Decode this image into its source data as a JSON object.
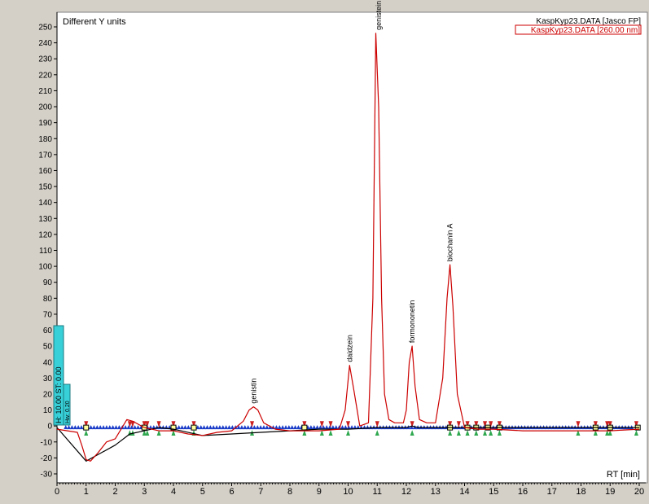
{
  "chart_data": {
    "type": "line",
    "title": "Different Y units",
    "xlabel": "RT [min]",
    "ylabel": "",
    "xlim": [
      0,
      20
    ],
    "ylim": [
      -35,
      255
    ],
    "x_ticks": [
      0,
      1,
      2,
      3,
      4,
      5,
      6,
      7,
      8,
      9,
      10,
      11,
      12,
      13,
      14,
      15,
      16,
      17,
      18,
      19,
      20
    ],
    "y_ticks": [
      -30,
      -20,
      -10,
      0,
      10,
      20,
      30,
      40,
      50,
      60,
      70,
      80,
      90,
      100,
      110,
      120,
      130,
      140,
      150,
      160,
      170,
      180,
      190,
      200,
      210,
      220,
      230,
      240,
      250
    ],
    "legend": {
      "placement": "top-right",
      "entries": [
        "KaspKyp23.DATA [Jasco FP]",
        "KaspKyp23.DATA [260.00 nm]"
      ]
    },
    "series": [
      {
        "name": "KaspKyp23.DATA [Jasco FP]",
        "color": "#000000",
        "x": [
          0,
          1.0,
          1.5,
          2.0,
          2.5,
          3.0,
          3.5,
          4.0,
          5.0,
          6.0,
          7.0,
          8.0,
          9.0,
          10.0,
          11.0,
          12.0,
          12.2,
          12.4,
          13.0,
          14.0,
          15.0,
          16.0,
          17.0,
          18.0,
          19.0,
          20.0
        ],
        "y": [
          -1,
          -22,
          -17,
          -12,
          -5,
          -3,
          -1,
          -2,
          -6,
          -5,
          -4,
          -3,
          -2,
          -2,
          -1,
          -1,
          0,
          -1,
          -1,
          -1,
          -1,
          -1,
          -1,
          -1,
          -1,
          -1
        ]
      },
      {
        "name": "KaspKyp23.DATA [260.00 nm]",
        "color": "#cc0000",
        "x": [
          0,
          0.7,
          0.85,
          1.0,
          1.15,
          1.4,
          1.7,
          2.0,
          2.2,
          2.4,
          2.6,
          3.0,
          3.5,
          4.0,
          4.5,
          5.0,
          5.5,
          6.0,
          6.4,
          6.6,
          6.75,
          6.9,
          7.1,
          7.5,
          8.0,
          9.0,
          9.7,
          9.9,
          10.05,
          10.2,
          10.4,
          10.7,
          10.85,
          10.95,
          11.05,
          11.15,
          11.25,
          11.4,
          11.6,
          11.9,
          12.0,
          12.1,
          12.2,
          12.3,
          12.45,
          12.7,
          13.0,
          13.25,
          13.4,
          13.5,
          13.6,
          13.75,
          14.0,
          14.5,
          15.0,
          16.0,
          17.0,
          18.0,
          19.0,
          20.0
        ],
        "y": [
          -2,
          -4,
          -12,
          -21,
          -22,
          -17,
          -10,
          -8,
          -2,
          4,
          3,
          -1,
          -3,
          -3,
          -5,
          -6,
          -4,
          -3,
          3,
          10,
          12,
          10,
          2,
          -2,
          -3,
          -3,
          -2,
          10,
          38,
          22,
          0,
          2,
          80,
          246,
          200,
          80,
          20,
          4,
          2,
          2,
          10,
          40,
          50,
          25,
          4,
          2,
          2,
          30,
          80,
          101,
          75,
          20,
          -1,
          -2,
          -2,
          -3,
          -3,
          -3,
          -3,
          -2
        ]
      }
    ],
    "annotations": [
      {
        "text": "genistin",
        "x": 6.75,
        "y": 12
      },
      {
        "text": "daidzein",
        "x": 10.05,
        "y": 38
      },
      {
        "text": "genistein",
        "x": 11.05,
        "y": 246
      },
      {
        "text": "formononetin",
        "x": 12.2,
        "y": 50
      },
      {
        "text": "biochanin A",
        "x": 13.5,
        "y": 101
      }
    ],
    "side_labels": [
      "H: 10.00  ST: 0.00",
      "Hw: 0.20"
    ],
    "grid": false
  },
  "colors": {
    "background": "#ffffff",
    "frame": "#d4d0c8",
    "red_trace": "#cc0000",
    "black_trace": "#000000",
    "blue_marker": "#1a3cc8",
    "green_marker": "#2fa84f",
    "red_marker": "#cc2020",
    "side_box": "#38d0d8"
  }
}
